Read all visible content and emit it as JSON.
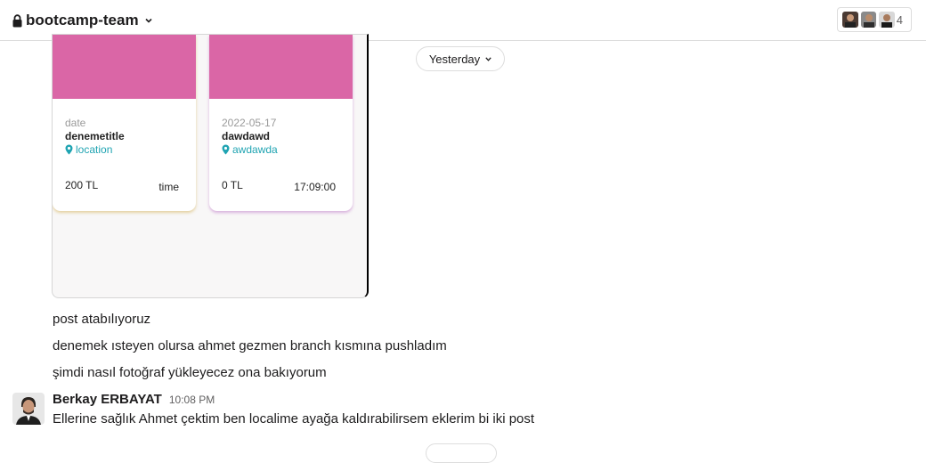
{
  "header": {
    "channel_name": "bootcamp-team",
    "member_count": "4",
    "icons": [
      "lock-icon",
      "chevron-down-icon"
    ]
  },
  "attachment": {
    "cards": [
      {
        "date": "date",
        "title": "denemetitle",
        "location": "location",
        "price": "200 TL",
        "time": "time"
      },
      {
        "date": "2022-05-17",
        "title": "dawdawd",
        "location": "awdawda",
        "price": "0 TL",
        "time": "17:09:00"
      }
    ],
    "colors": {
      "card_image": "#da66a6",
      "location_text": "#20a4b2"
    }
  },
  "date_divider": {
    "label": "Yesterday"
  },
  "messages": [
    {
      "text": "post atabılıyoruz"
    },
    {
      "text": "denemek ısteyen olursa ahmet gezmen branch kısmına pushladım"
    },
    {
      "text": "şimdi nasıl fotoğraf yükleyecez ona bakıyorum"
    }
  ],
  "last_message": {
    "author": "Berkay ERBAYAT",
    "time": "10:08 PM",
    "text": "Ellerine sağlık Ahmet çektim ben localime ayağa kaldırabilirsem eklerim bi iki post"
  }
}
